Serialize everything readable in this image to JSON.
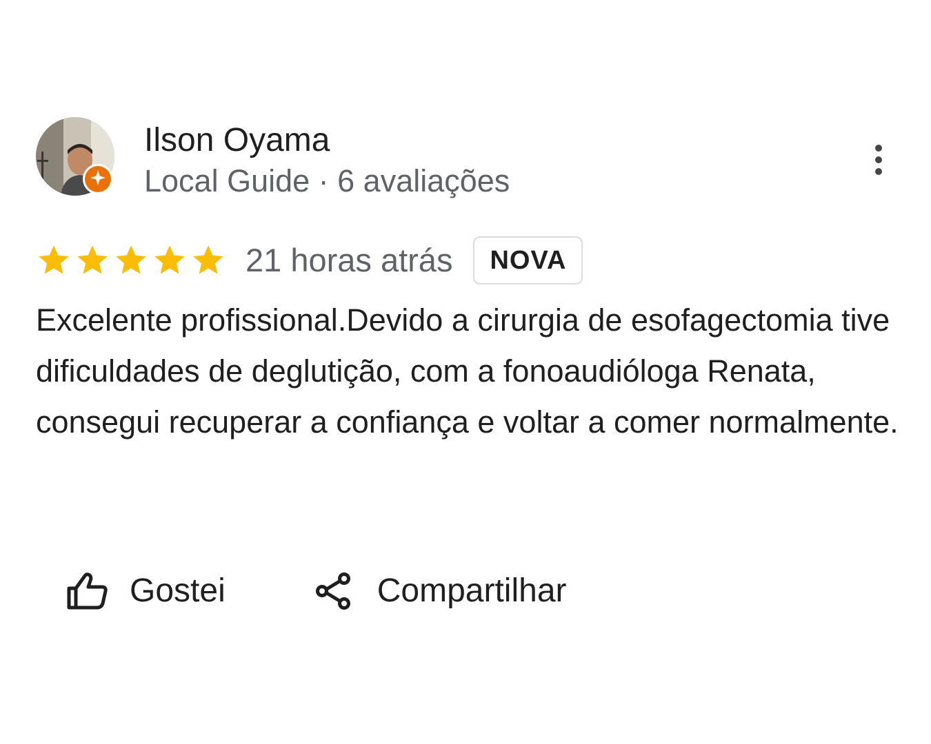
{
  "review": {
    "author": {
      "name": "Ilson Oyama",
      "meta": "Local Guide · 6 avaliações",
      "badge_icon": "local-guide-star-icon"
    },
    "rating": {
      "stars": 5,
      "max": 5,
      "color": "#fbbc04"
    },
    "time": "21 horas atrás",
    "badge": "NOVA",
    "text": "Excelente profissional.Devido a cirurgia de esofagectomia tive dificuldades de deglutição, com a fonoaudióloga Renata, consegui recuperar a confiança e voltar a comer normalmente.",
    "actions": {
      "like_label": "Gostei",
      "like_icon": "thumbs-up-icon",
      "share_label": "Compartilhar",
      "share_icon": "share-icon"
    },
    "menu_icon": "more-vert-icon"
  },
  "colors": {
    "guide_orange": "#e8710a",
    "text_primary": "#1f1f1f",
    "text_secondary": "#5f6368"
  }
}
